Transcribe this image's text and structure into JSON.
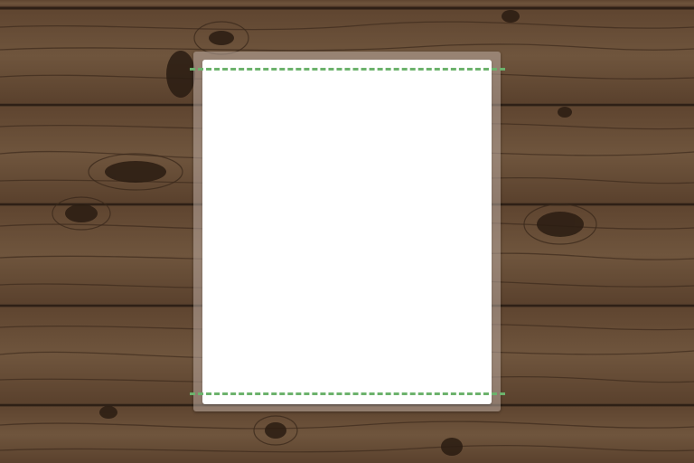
{
  "colors": {
    "background": "#6a5038",
    "sheet": "#ffffff",
    "frame": "#b9aaa0",
    "guide": "#6cb26c"
  },
  "icons": {
    "background": "wood-texture",
    "guides": "dashed-crop-line"
  }
}
